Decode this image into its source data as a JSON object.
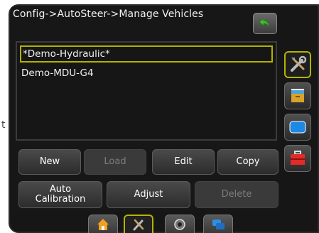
{
  "edge_text": "t",
  "header": {
    "breadcrumb": "Config->AutoSteer->Manage Vehicles"
  },
  "vehicles": [
    {
      "name": "*Demo-Hydraulic*",
      "selected": true
    },
    {
      "name": "Demo-MDU-G4",
      "selected": false
    }
  ],
  "actions_row1": [
    {
      "label": "New",
      "enabled": true
    },
    {
      "label": "Load",
      "enabled": false
    },
    {
      "label": "Edit",
      "enabled": true
    },
    {
      "label": "Copy",
      "enabled": true
    }
  ],
  "actions_row2": [
    {
      "label": "Auto\nCalibration",
      "enabled": true
    },
    {
      "label": "Adjust",
      "enabled": true
    },
    {
      "label": "Delete",
      "enabled": false
    }
  ],
  "side_nav": [
    {
      "icon": "tools-icon",
      "active": true
    },
    {
      "icon": "file-cabinet-icon",
      "active": false
    },
    {
      "icon": "display-icon",
      "active": false
    },
    {
      "icon": "toolbox-icon",
      "active": false
    }
  ],
  "bottom_tabs": [
    {
      "icon": "home-icon",
      "active": false
    },
    {
      "icon": "tools-icon",
      "active": true
    },
    {
      "icon": "gauge-icon",
      "active": false
    },
    {
      "icon": "windows-icon",
      "active": false
    }
  ],
  "colors": {
    "highlight": "#b3b300",
    "background": "#161616",
    "back_arrow": "#3fbf2a"
  }
}
